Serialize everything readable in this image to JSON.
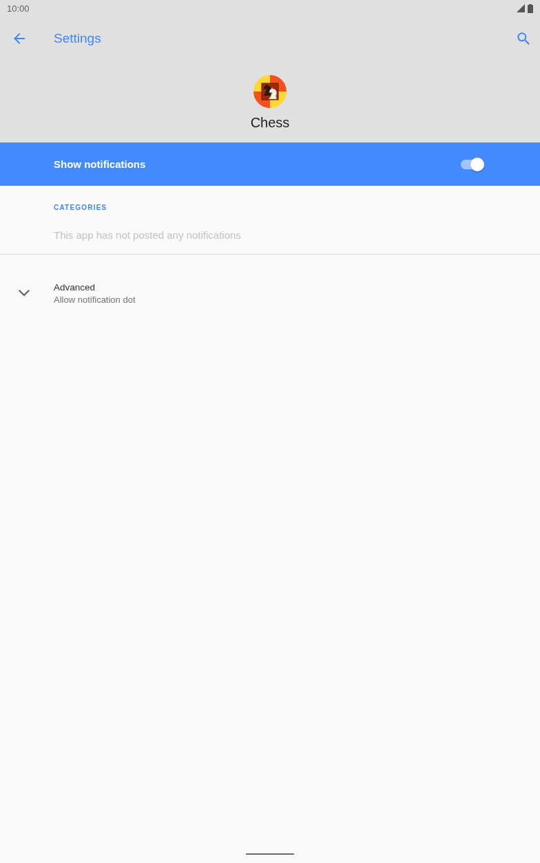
{
  "status_bar": {
    "time": "10:00"
  },
  "toolbar": {
    "title": "Settings"
  },
  "app_header": {
    "app_name": "Chess"
  },
  "master_switch": {
    "label": "Show notifications",
    "on": true
  },
  "categories": {
    "header": "CATEGORIES",
    "empty_message": "This app has not posted any notifications"
  },
  "advanced": {
    "title": "Advanced",
    "summary": "Allow notification dot",
    "expanded": false
  }
}
